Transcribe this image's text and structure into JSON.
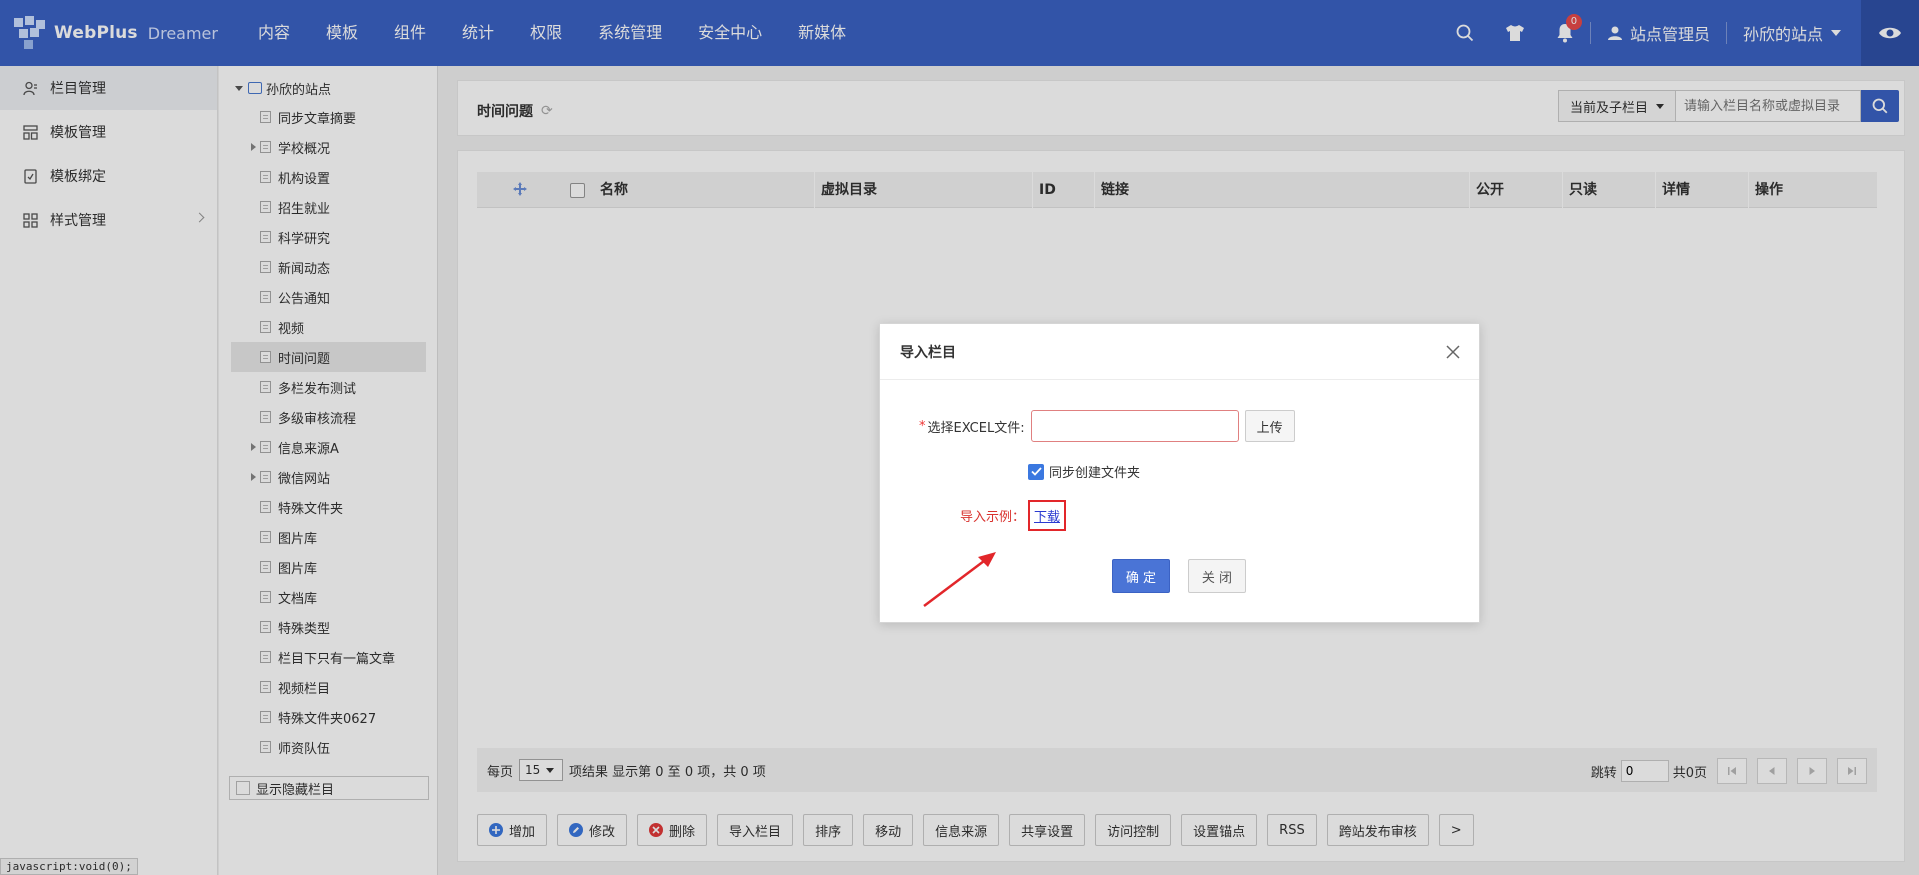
{
  "topbar": {
    "brand": "WebPlus",
    "brand_sub": "Dreamer",
    "nav": [
      "内容",
      "模板",
      "组件",
      "统计",
      "权限",
      "系统管理",
      "安全中心",
      "新媒体"
    ],
    "notification_count": "0",
    "admin_label": "站点管理员",
    "site_label": "孙欣的站点",
    "bg_color": "#3b62c4"
  },
  "sidebar": {
    "items": [
      {
        "label": "栏目管理",
        "icon": "users-icon"
      },
      {
        "label": "模板管理",
        "icon": "template-icon"
      },
      {
        "label": "模板绑定",
        "icon": "bind-icon"
      },
      {
        "label": "样式管理",
        "icon": "grid-icon"
      }
    ],
    "status_text": "javascript:void(0);"
  },
  "tree": {
    "root": "孙欣的站点",
    "nodes": [
      {
        "label": "同步文章摘要",
        "expandable": false
      },
      {
        "label": "学校概况",
        "expandable": true
      },
      {
        "label": "机构设置",
        "expandable": false
      },
      {
        "label": "招生就业",
        "expandable": false
      },
      {
        "label": "科学研究",
        "expandable": false
      },
      {
        "label": "新闻动态",
        "expandable": false
      },
      {
        "label": "公告通知",
        "expandable": false
      },
      {
        "label": "视频",
        "expandable": false
      },
      {
        "label": "时间问题",
        "expandable": false,
        "selected": true
      },
      {
        "label": "多栏发布测试",
        "expandable": false
      },
      {
        "label": "多级审核流程",
        "expandable": false
      },
      {
        "label": "信息来源A",
        "expandable": true
      },
      {
        "label": "微信网站",
        "expandable": true
      },
      {
        "label": "特殊文件夹",
        "expandable": false
      },
      {
        "label": "图片库",
        "expandable": false
      },
      {
        "label": "图片库",
        "expandable": false
      },
      {
        "label": "文档库",
        "expandable": false
      },
      {
        "label": "特殊类型",
        "expandable": false
      },
      {
        "label": "栏目下只有一篇文章",
        "expandable": false
      },
      {
        "label": "视频栏目",
        "expandable": false
      },
      {
        "label": "特殊文件夹0627",
        "expandable": false
      },
      {
        "label": "师资队伍",
        "expandable": false
      }
    ],
    "show_hidden_label": "显示隐藏栏目"
  },
  "main": {
    "title": "时间问题",
    "scope_select": "当前及子栏目",
    "search_placeholder": "请输入栏目名称或虚拟目录",
    "columns": [
      "名称",
      "虚拟目录",
      "ID",
      "链接",
      "公开",
      "只读",
      "详情",
      "操作"
    ],
    "pager": {
      "per_page_label": "每页",
      "page_size": "15",
      "result_text": "项结果 显示第 0 至 0 项，共 0 项",
      "jump_label": "跳转",
      "jump_value": "0",
      "total_pages": "共0页"
    },
    "actions": [
      "增加",
      "修改",
      "删除",
      "导入栏目",
      "排序",
      "移动",
      "信息来源",
      "共享设置",
      "访问控制",
      "设置锚点",
      "RSS",
      "跨站发布审核",
      ">"
    ]
  },
  "dialog": {
    "title": "导入栏目",
    "file_label": "选择EXCEL文件:",
    "upload_label": "上传",
    "sync_folder_label": "同步创建文件夹",
    "sync_folder_checked": true,
    "example_label": "导入示例：",
    "download_label": "下载",
    "ok_label": "确 定",
    "close_label": "关 闭"
  }
}
